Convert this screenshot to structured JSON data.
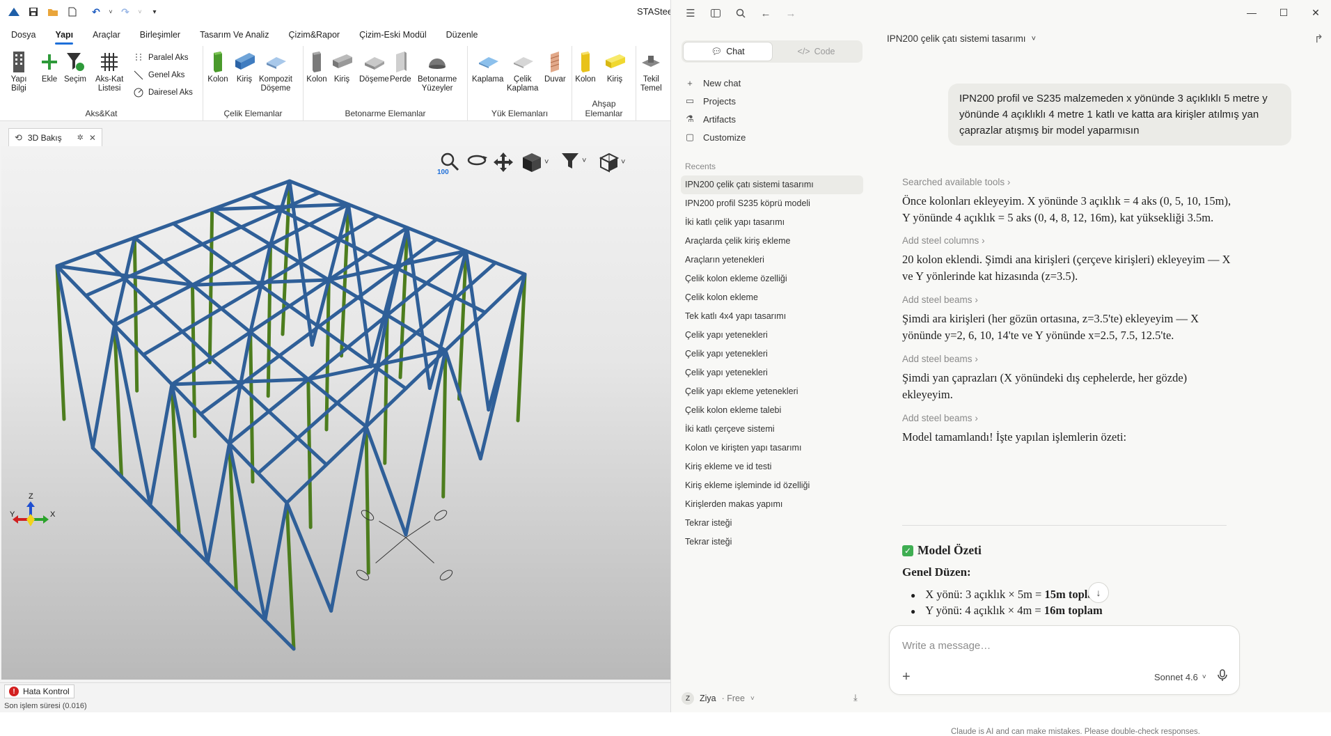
{
  "app": {
    "title": "STASteel",
    "menu": [
      "Dosya",
      "Yapı",
      "Araçlar",
      "Birleşimler",
      "Tasarım Ve Analiz",
      "Çizim&Rapor",
      "Çizim-Eski Modül",
      "Düzenle"
    ],
    "active_menu": "Yapı",
    "ribbon": {
      "aks_kat": {
        "label": "Aks&Kat",
        "yapi_bilgi": "Yapı\nBilgi",
        "ekle": "Ekle",
        "secim": "Seçim",
        "aks_kat_listesi": "Aks-Kat\nListesi",
        "paralel_aks": "Paralel Aks",
        "genel_aks": "Genel Aks",
        "dairesel_aks": "Dairesel Aks"
      },
      "celik": {
        "label": "Çelik Elemanlar",
        "kolon": "Kolon",
        "kiris": "Kiriş",
        "kompozit": "Kompozit\nDöşeme"
      },
      "betonarme": {
        "label": "Betonarme Elemanlar",
        "kolon": "Kolon",
        "kiris": "Kiriş",
        "doseme": "Döşeme",
        "perde": "Perde",
        "yuzeyler": "Betonarme\nYüzeyler"
      },
      "yuk": {
        "label": "Yük Elemanları",
        "kaplama": "Kaplama",
        "celik_kaplama": "Çelik\nKaplama",
        "duvar": "Duvar"
      },
      "ahsap": {
        "label": "Ahşap Elemanlar",
        "kolon": "Kolon",
        "kiris": "Kiriş"
      },
      "temel": {
        "tekil_temel": "Tekil\nTemel"
      }
    },
    "doc_tab": "3D Bakış",
    "zoom_label": "100",
    "status_button": "Hata Kontrol",
    "bottom_text": "Son işlem süresi (0.016)",
    "axis_labels": {
      "x": "X",
      "y": "Y",
      "z": "Z"
    }
  },
  "claude": {
    "segment": {
      "chat": "Chat",
      "code": "Code"
    },
    "nav": [
      "New chat",
      "Projects",
      "Artifacts",
      "Customize"
    ],
    "recents_header": "Recents",
    "recents": [
      "IPN200 çelik çatı sistemi tasarımı",
      "IPN200 profil S235 köprü modeli",
      "İki katlı çelik yapı tasarımı",
      "Araçlarda çelik kiriş ekleme",
      "Araçların yetenekleri",
      "Çelik kolon ekleme özelliği",
      "Çelik kolon ekleme",
      "Tek katlı 4x4 yapı tasarımı",
      "Çelik yapı yetenekleri",
      "Çelik yapı yetenekleri",
      "Çelik yapı yetenekleri",
      "Çelik yapı ekleme yetenekleri",
      "Çelik kolon ekleme talebi",
      "İki katlı çerçeve sistemi",
      "Kolon ve kirişten yapı tasarımı",
      "Kiriş ekleme ve id testi",
      "Kiriş ekleme işleminde id özelliği",
      "Kirişlerden makas yapımı",
      "Tekrar isteği",
      "Tekrar isteği"
    ],
    "user": {
      "initial": "Z",
      "name": "Ziya",
      "plan": "· Free"
    },
    "conversation_title": "IPN200 çelik çatı sistemi tasarımı",
    "user_message": "IPN200 profil ve S235 malzemeden  x yönünde 3 açıklıklı 5 metre y yönünde 4 açıklıklı 4 metre 1 katlı  ve katta ara kirişler atılmış yan çaprazlar atışmış bir model yaparmısın",
    "tools": [
      "Searched available tools",
      "Add steel columns",
      "Add steel beams",
      "Add steel beams",
      "Add steel beams"
    ],
    "paragraphs": [
      "Önce kolonları ekleyeyim. X yönünde 3 açıklık = 4 aks (0, 5, 10, 15m), Y yönünde 4 açıklık = 5 aks (0, 4, 8, 12, 16m), kat yüksekliği 3.5m.",
      "20 kolon eklendi. Şimdi ana kirişleri (çerçeve kirişleri) ekleyeyim — X ve Y yönlerinde kat hizasında (z=3.5).",
      "Şimdi ara kirişleri (her gözün ortasına, z=3.5'te) ekleyeyim — X yönünde y=2, 6, 10, 14'te ve Y yönünde x=2.5, 7.5, 12.5'te.",
      "Şimdi yan çaprazları (X yönündeki dış cephelerde, her gözde) ekleyeyim.",
      "Model tamamlandı! İşte yapılan işlemlerin özeti:"
    ],
    "summary_title": "Model Özeti",
    "summary_subtitle": "Genel Düzen:",
    "bullets": [
      {
        "text": "X yönü: 3 açıklık × 5m = ",
        "bold": "15m toplam"
      },
      {
        "text": "Y yönü: 4 açıklık × 4m = ",
        "bold": "16m toplam"
      }
    ],
    "composer_placeholder": "Write a message…",
    "model": "Sonnet 4.6",
    "disclaimer": "Claude is AI and can make mistakes. Please double-check responses."
  }
}
